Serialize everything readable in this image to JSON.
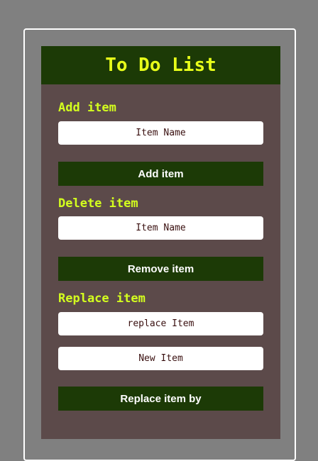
{
  "app": {
    "title": "To Do List"
  },
  "add_section": {
    "heading": "Add item",
    "input_placeholder": "Item Name",
    "button_label": "Add item"
  },
  "delete_section": {
    "heading": "Delete item",
    "input_placeholder": "Item Name",
    "button_label": "Remove item"
  },
  "replace_section": {
    "heading": "Replace item",
    "old_input_placeholder": "replace Item",
    "new_input_placeholder": "New Item",
    "button_label": "Replace item by"
  },
  "colors": {
    "page_background": "#808080",
    "panel_background": "#5c4a4a",
    "header_background": "#1c3a06",
    "button_background": "#1c3a06",
    "heading_text": "#d4ff1e",
    "field_text": "#3a1010"
  }
}
